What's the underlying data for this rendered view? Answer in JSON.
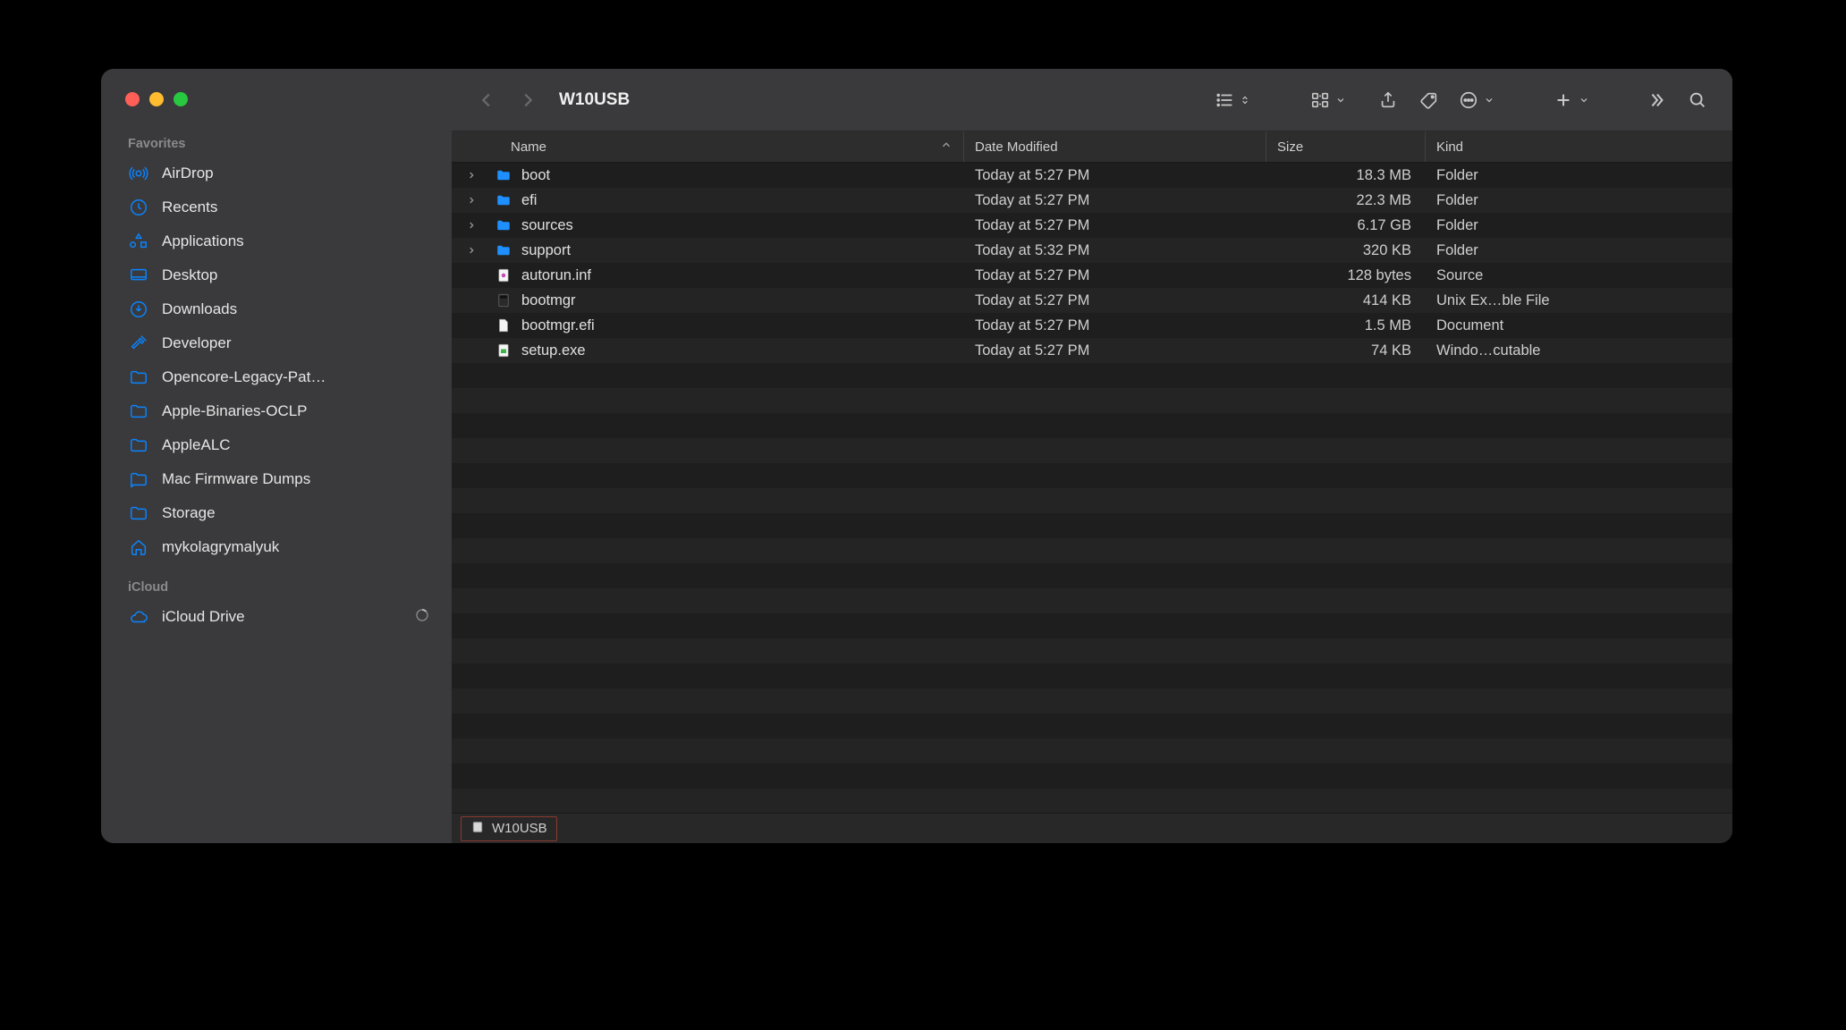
{
  "window": {
    "title": "W10USB"
  },
  "sidebar": {
    "sections": [
      {
        "label": "Favorites",
        "items": [
          {
            "icon": "airdrop-icon",
            "label": "AirDrop"
          },
          {
            "icon": "clock-icon",
            "label": "Recents"
          },
          {
            "icon": "apps-icon",
            "label": "Applications"
          },
          {
            "icon": "desktop-icon",
            "label": "Desktop"
          },
          {
            "icon": "download-icon",
            "label": "Downloads"
          },
          {
            "icon": "hammer-icon",
            "label": "Developer"
          },
          {
            "icon": "folder-icon",
            "label": "Opencore-Legacy-Pat…"
          },
          {
            "icon": "folder-icon",
            "label": "Apple-Binaries-OCLP"
          },
          {
            "icon": "folder-icon",
            "label": "AppleALC"
          },
          {
            "icon": "folder-icon",
            "label": "Mac Firmware Dumps"
          },
          {
            "icon": "folder-icon",
            "label": "Storage"
          },
          {
            "icon": "home-icon",
            "label": "mykolagrymalyuk"
          }
        ]
      },
      {
        "label": "iCloud",
        "items": [
          {
            "icon": "cloud-icon",
            "label": "iCloud Drive",
            "trailing": "progress-icon"
          }
        ]
      }
    ]
  },
  "toolbar": {
    "back_disabled": true,
    "forward_disabled": true
  },
  "columns": {
    "name": "Name",
    "date": "Date Modified",
    "size": "Size",
    "kind": "Kind"
  },
  "rows": [
    {
      "type": "folder",
      "expandable": true,
      "name": "boot",
      "date": "Today at 5:27 PM",
      "size": "18.3 MB",
      "kind": "Folder"
    },
    {
      "type": "folder",
      "expandable": true,
      "name": "efi",
      "date": "Today at 5:27 PM",
      "size": "22.3 MB",
      "kind": "Folder"
    },
    {
      "type": "folder",
      "expandable": true,
      "name": "sources",
      "date": "Today at 5:27 PM",
      "size": "6.17 GB",
      "kind": "Folder"
    },
    {
      "type": "folder",
      "expandable": true,
      "name": "support",
      "date": "Today at 5:32 PM",
      "size": "320 KB",
      "kind": "Folder"
    },
    {
      "type": "inf",
      "expandable": false,
      "name": "autorun.inf",
      "date": "Today at 5:27 PM",
      "size": "128 bytes",
      "kind": "Source"
    },
    {
      "type": "exec",
      "expandable": false,
      "name": "bootmgr",
      "date": "Today at 5:27 PM",
      "size": "414 KB",
      "kind": "Unix Ex…ble File"
    },
    {
      "type": "doc",
      "expandable": false,
      "name": "bootmgr.efi",
      "date": "Today at 5:27 PM",
      "size": "1.5 MB",
      "kind": "Document"
    },
    {
      "type": "exe",
      "expandable": false,
      "name": "setup.exe",
      "date": "Today at 5:27 PM",
      "size": "74 KB",
      "kind": "Windo…cutable"
    }
  ],
  "pathbar": {
    "segment": "W10USB"
  }
}
